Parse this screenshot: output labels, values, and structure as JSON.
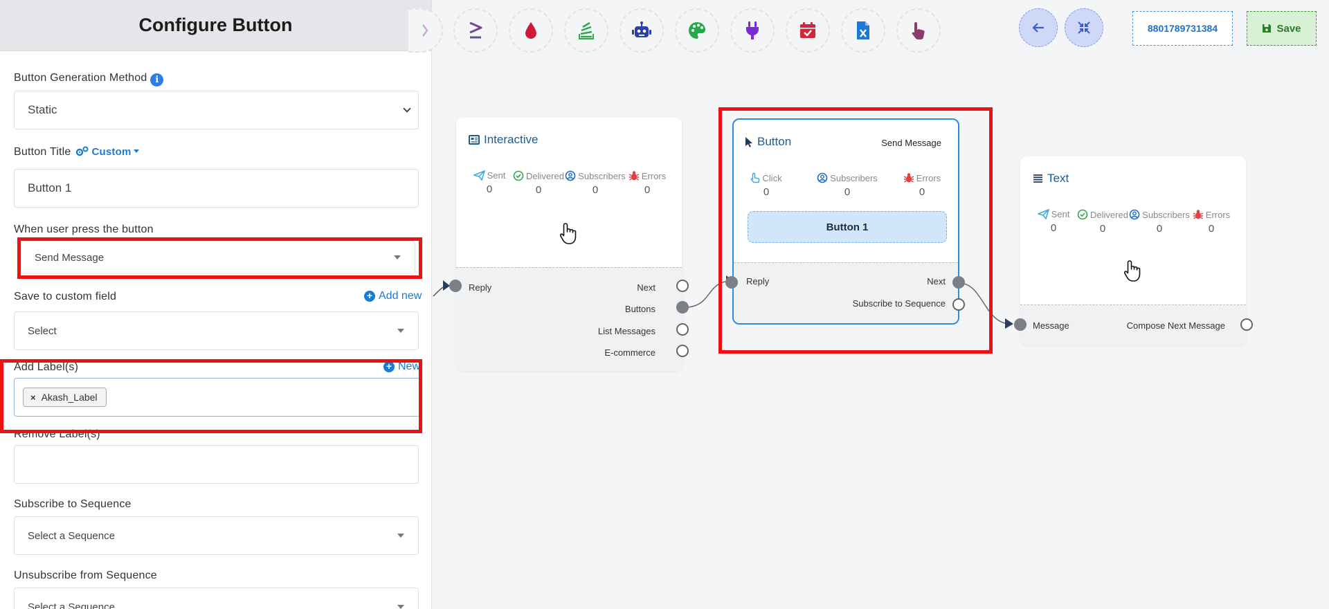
{
  "panel": {
    "title": "Configure Button",
    "generation_method": {
      "label": "Button Generation Method",
      "value": "Static"
    },
    "button_title": {
      "label": "Button Title",
      "custom_label": "Custom",
      "value": "Button 1"
    },
    "on_press": {
      "label": "When user press the button",
      "value": "Send Message"
    },
    "custom_field": {
      "label": "Save to custom field",
      "add_new": "Add new",
      "value": "Select"
    },
    "add_labels": {
      "label": "Add Label(s)",
      "new_link": "New",
      "tags": [
        "Akash_Label"
      ]
    },
    "remove_labels": {
      "label": "Remove Label(s)"
    },
    "subscribe": {
      "label": "Subscribe to Sequence",
      "value": "Select a Sequence"
    },
    "unsubscribe": {
      "label": "Unsubscribe from Sequence",
      "value": "Select a Sequence"
    }
  },
  "toolbar": {
    "tools": [
      "greater-equal-icon",
      "drop-icon",
      "stack-icon",
      "robot-icon",
      "palette-icon",
      "plug-icon",
      "calendar-check-icon",
      "excel-file-icon",
      "pointer-hand-icon"
    ],
    "phone": "8801789731384",
    "save_label": "Save"
  },
  "nodes": {
    "interactive": {
      "title": "Interactive",
      "stats": [
        {
          "label": "Sent",
          "value": "0"
        },
        {
          "label": "Delivered",
          "value": "0"
        },
        {
          "label": "Subscribers",
          "value": "0"
        },
        {
          "label": "Errors",
          "value": "0"
        }
      ],
      "input_port": "Reply",
      "outputs": [
        "Next",
        "Buttons",
        "List Messages",
        "E-commerce"
      ]
    },
    "button": {
      "title": "Button",
      "badge": "Send Message",
      "stats": [
        {
          "label": "Click",
          "value": "0"
        },
        {
          "label": "Subscribers",
          "value": "0"
        },
        {
          "label": "Errors",
          "value": "0"
        }
      ],
      "preview": "Button 1",
      "input_port": "Reply",
      "outputs": [
        "Next",
        "Subscribe to Sequence"
      ]
    },
    "text": {
      "title": "Text",
      "stats": [
        {
          "label": "Sent",
          "value": "0"
        },
        {
          "label": "Delivered",
          "value": "0"
        },
        {
          "label": "Subscribers",
          "value": "0"
        },
        {
          "label": "Errors",
          "value": "0"
        }
      ],
      "input_port": "Message",
      "output_port": "Compose Next Message"
    }
  },
  "colors": {
    "accent": "#1a7bd6",
    "highlight": "#ee1111",
    "save_green": "#2b7d2b"
  }
}
